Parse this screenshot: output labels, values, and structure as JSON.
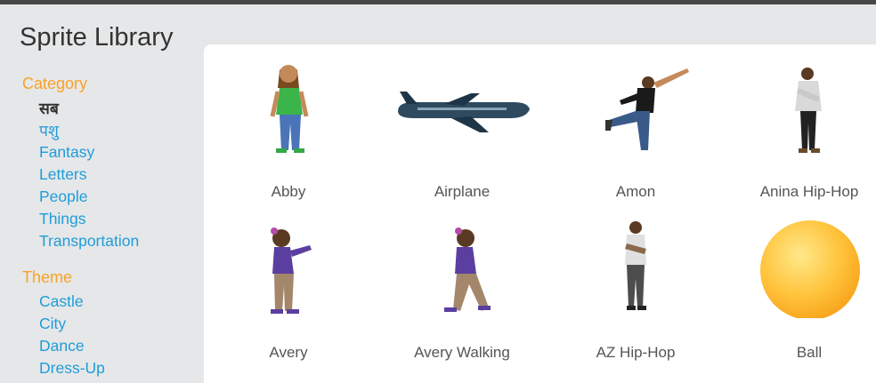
{
  "title": "Sprite Library",
  "category": {
    "heading": "Category",
    "items": [
      "सब",
      "पशु",
      "Fantasy",
      "Letters",
      "People",
      "Things",
      "Transportation"
    ],
    "selected_index": 0
  },
  "theme": {
    "heading": "Theme",
    "items": [
      "Castle",
      "City",
      "Dance",
      "Dress-Up"
    ]
  },
  "sprites": [
    "Abby",
    "Airplane",
    "Amon",
    "Anina Hip-Hop",
    "Avery",
    "Avery Walking",
    "AZ Hip-Hop",
    "Ball"
  ],
  "colors": {
    "heading": "#f9a229",
    "link": "#1e9ddb",
    "selected": "#333333",
    "panel_bg": "#ffffff",
    "page_bg": "#e6e7e8"
  }
}
